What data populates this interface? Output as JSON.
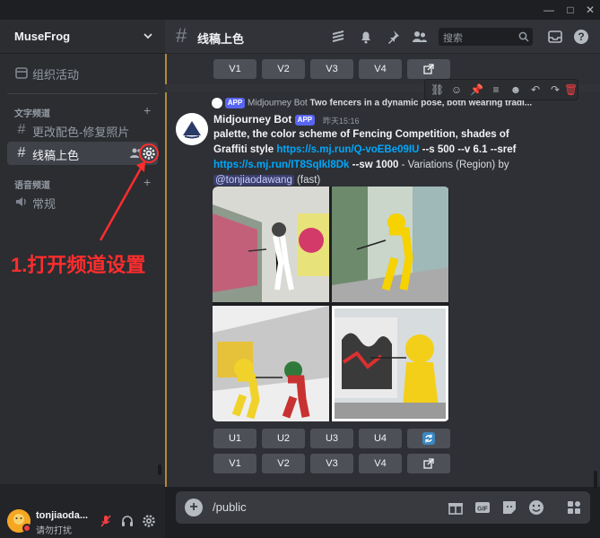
{
  "window": {
    "controls": [
      "—",
      "□",
      "✕"
    ]
  },
  "server": {
    "name": "MuseFrog"
  },
  "sidebar": {
    "event_label": "组织活动",
    "text_category": "文字频道",
    "voice_category": "语音频道",
    "channels": [
      {
        "label": "更改配色-修复照片"
      },
      {
        "label": "线稿上色"
      }
    ],
    "voice_channels": [
      {
        "label": "常规"
      }
    ]
  },
  "user": {
    "name": "tonjiaoda...",
    "status": "请勿打扰"
  },
  "topbar": {
    "channel_title": "线稿上色",
    "search_placeholder": "搜索"
  },
  "buttons": {
    "v": [
      "V1",
      "V2",
      "V3",
      "V4"
    ],
    "u": [
      "U1",
      "U2",
      "U3",
      "U4"
    ]
  },
  "message": {
    "reply_author": "Midjourney Bot",
    "reply_text": "Two fencers in a dynamic pose, both wearing tradi...",
    "app_badge": "APP",
    "author": "Midjourney Bot",
    "time": "昨天15:16",
    "prompt_line1": "palette, the color scheme of Fencing Competition, shades of Graffiti style",
    "link1": "https://s.mj.run/Q-voEBe09IU",
    "params1": "--s 500 --v 6.1 --sref",
    "link2": "https://s.mj.run/IT8SqIkl8Dk",
    "params2": "--sw 1000",
    "variation": "- Variations (Region) by",
    "mention": "@tonjiaodawang",
    "speed": "(fast)"
  },
  "input": {
    "value": "/public"
  },
  "annotation": {
    "text": "1.打开频道设置"
  },
  "colors": {
    "accent": "#5865f2",
    "annotation": "#ff2d2d",
    "link": "#00a8fc",
    "highlight_bar": "#b08a3a"
  }
}
